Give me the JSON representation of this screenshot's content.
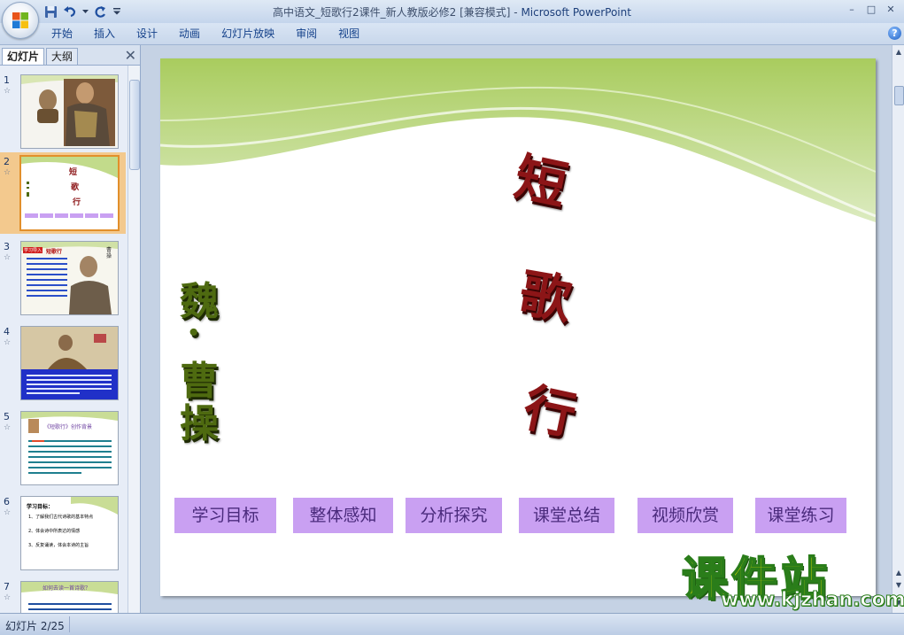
{
  "window": {
    "title": "高中语文_短歌行2课件_新人教版必修2 [兼容模式]",
    "separator": " - ",
    "app_name": "Microsoft PowerPoint",
    "controls": [
      "–",
      "□",
      "✕"
    ]
  },
  "quick_access": [
    {
      "name": "save-icon"
    },
    {
      "name": "undo-icon"
    },
    {
      "name": "undo-dropdown-icon"
    },
    {
      "name": "redo-icon"
    },
    {
      "name": "customize-qat-icon"
    }
  ],
  "ribbon": {
    "tabs": [
      "开始",
      "插入",
      "设计",
      "动画",
      "幻灯片放映",
      "审阅",
      "视图"
    ],
    "help": "?"
  },
  "left_panel": {
    "tabs": {
      "slides": "幻灯片",
      "outline": "大纲"
    },
    "close": "✕",
    "thumbnails": [
      {
        "number": "1",
        "active": false
      },
      {
        "number": "2",
        "active": true
      },
      {
        "number": "3",
        "active": false
      },
      {
        "number": "4",
        "active": false
      },
      {
        "number": "5",
        "active": false
      },
      {
        "number": "6",
        "active": false
      },
      {
        "number": "7",
        "active": false
      }
    ],
    "thumb_texts": {
      "t2_title": [
        "短",
        "歌",
        "行"
      ],
      "t3_badge": "学习导入",
      "t3_head": "短歌行",
      "t3_side": "曹操",
      "t5_head": "《短歌行》创作背景",
      "t6_head": "学习目标：",
      "t6_lines": [
        "1、了解我们古代诗歌的基本特点",
        "2、体会诗中所表达的情感",
        "3、反复诵读，体会本诗的主旨"
      ],
      "t7_head": "如何去读一首诗歌？"
    }
  },
  "slide": {
    "title_chars": [
      "短",
      "歌",
      "行"
    ],
    "author_chars": [
      "魏",
      "·",
      "曹",
      "操"
    ],
    "nav_buttons": [
      "学习目标",
      "整体感知",
      "分析探究",
      "课堂总结",
      "视频欣赏",
      "课堂练习"
    ],
    "colors": {
      "title": "#8c1517",
      "author": "#4e6a10",
      "button": "#c9a0f2",
      "wave": "#b9d47a"
    }
  },
  "watermark": {
    "logo": "课件站",
    "url": "www.kjzhan.com"
  },
  "status": {
    "slide_indicator": "幻灯片 2/25"
  }
}
